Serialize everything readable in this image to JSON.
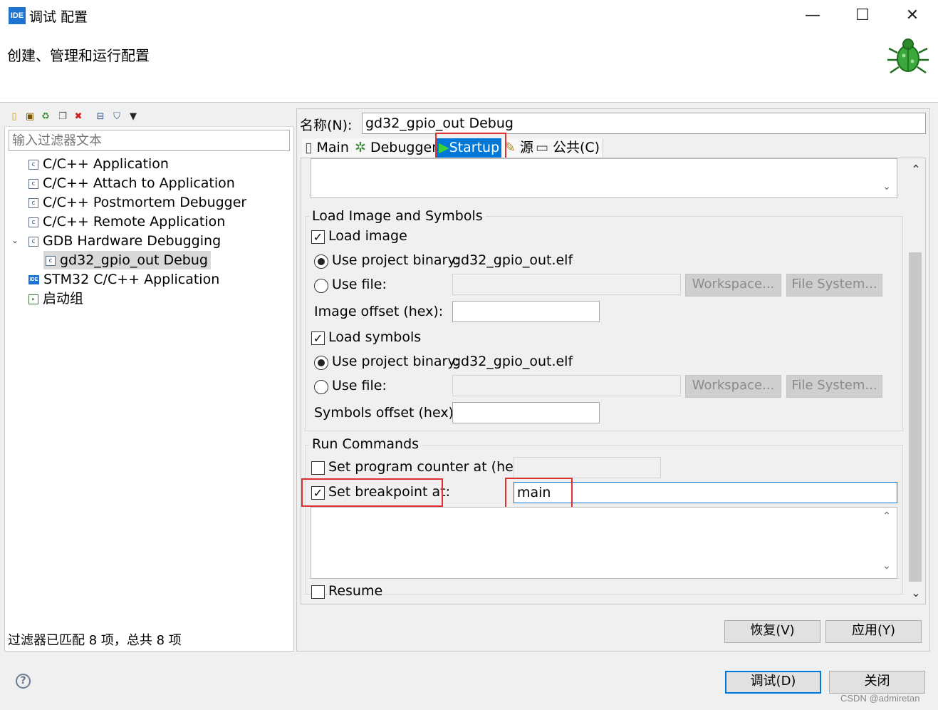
{
  "window": {
    "app_icon_text": "IDE",
    "title": "调试 配置",
    "minimize": "—",
    "maximize": "☐",
    "close": "✕"
  },
  "banner": {
    "title": "创建、管理和运行配置"
  },
  "left": {
    "filter_placeholder": "输入过滤器文本",
    "tree": [
      {
        "label": "C/C++ Application"
      },
      {
        "label": "C/C++ Attach to Application"
      },
      {
        "label": "C/C++ Postmortem Debugger"
      },
      {
        "label": "C/C++ Remote Application"
      },
      {
        "label": "GDB Hardware Debugging"
      },
      {
        "label": "gd32_gpio_out Debug"
      },
      {
        "label": "STM32 C/C++ Application"
      },
      {
        "label": "启动组"
      }
    ],
    "status": "过滤器已匹配 8 项，总共 8 项"
  },
  "right": {
    "name_label": "名称(N):",
    "name_value": "gd32_gpio_out Debug",
    "tabs": [
      "Main",
      "Debugger",
      "Startup",
      "源",
      "公共(C)"
    ],
    "load_group": {
      "title": "Load Image and Symbols",
      "load_image": "Load image",
      "use_project_binary": "Use project binary:",
      "binary_value": "gd32_gpio_out.elf",
      "use_file": "Use file:",
      "workspace": "Workspace...",
      "file_system": "File System...",
      "image_offset": "Image offset (hex):",
      "load_symbols": "Load symbols",
      "symbols_offset": "Symbols offset (hex):"
    },
    "run_group": {
      "title": "Run Commands",
      "set_pc": "Set program counter at (hex):",
      "set_breakpoint": "Set breakpoint at:",
      "breakpoint_value": "main",
      "resume": "Resume"
    },
    "revert": "恢复(V)",
    "apply": "应用(Y)"
  },
  "footer": {
    "debug": "调试(D)",
    "close": "关闭",
    "watermark": "CSDN @admiretan"
  },
  "colors": {
    "accent": "#0078d7",
    "highlight": "#e03030"
  }
}
